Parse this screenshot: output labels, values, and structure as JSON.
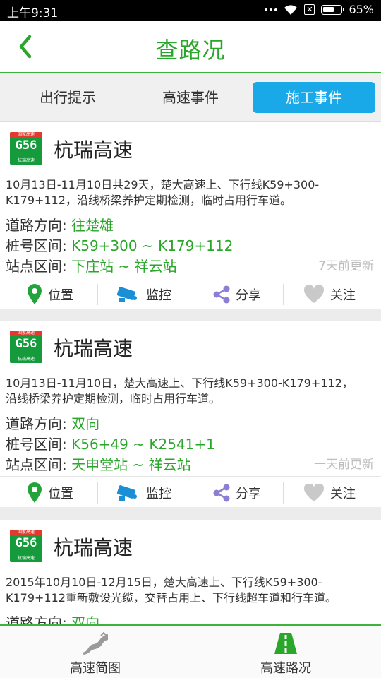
{
  "status_bar": {
    "time": "上午9:31",
    "battery": "65%",
    "battery_level": 0.65
  },
  "header": {
    "title": "查路况"
  },
  "tabs": [
    {
      "label": "出行提示",
      "active": false
    },
    {
      "label": "高速事件",
      "active": false
    },
    {
      "label": "施工事件",
      "active": true
    }
  ],
  "field_labels": {
    "direction": "道路方向:",
    "range": "桩号区间:",
    "stations": "站点区间:"
  },
  "actions": {
    "location": "位置",
    "monitor": "监控",
    "share": "分享",
    "follow": "关注"
  },
  "colors": {
    "accent_green": "#2aa62a",
    "tab_active": "#1aa9e8",
    "badge_green": "#159a3c",
    "badge_red": "#e23a2e"
  },
  "events": [
    {
      "badge": {
        "top": "国家高速",
        "code": "G56",
        "bottom": "杭瑞高速"
      },
      "road": "杭瑞高速",
      "desc_lines": [
        "10月13日-11月10日共29天，楚大高速上、下行线K59+300-",
        "K179+112，沿线桥梁养护定期检测，临时占用行车道。"
      ],
      "direction": "往楚雄",
      "range": "K59+300 ~ K179+112",
      "stations": "下庄站 ~ 祥云站",
      "updated": "7天前更新"
    },
    {
      "badge": {
        "top": "国家高速",
        "code": "G56",
        "bottom": "杭瑞高速"
      },
      "road": "杭瑞高速",
      "desc_lines": [
        "10月13日-11月10日，楚大高速上、下行线K59+300-K179+112，",
        "沿线桥梁养护定期检测，临时占用行车道。"
      ],
      "direction": "双向",
      "range": "K56+49 ~ K2541+1",
      "stations": "天申堂站 ~ 祥云站",
      "updated": "一天前更新"
    },
    {
      "badge": {
        "top": "国家高速",
        "code": "G56",
        "bottom": "杭瑞高速"
      },
      "road": "杭瑞高速",
      "desc_lines": [
        "2015年10月10日-12月15日，楚大高速上、下行线K59+300-",
        "K179+112重新敷设光缆，交替占用上、下行线超车道和行车道。"
      ],
      "direction": "双向"
    }
  ],
  "bottom_nav": [
    {
      "label": "高速简图",
      "icon": "highway-map-icon"
    },
    {
      "label": "高速路况",
      "icon": "road-icon"
    }
  ]
}
